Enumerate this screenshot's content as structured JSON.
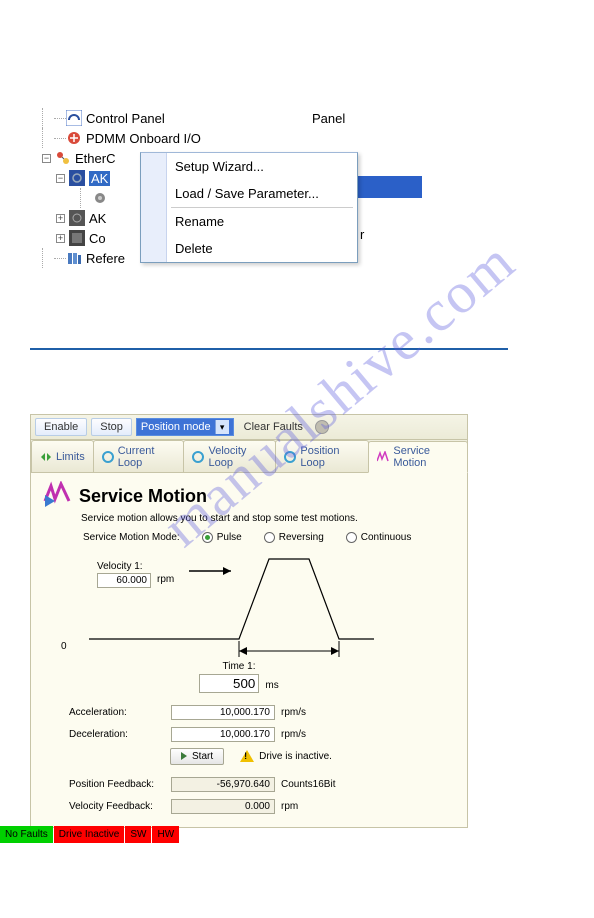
{
  "tree": {
    "control_panel": "Control Panel",
    "panel": "Panel",
    "pdmm": "PDMM Onboard I/O",
    "ether": "EtherC",
    "ak1": "AK",
    "ak2": "AK",
    "co": "Co",
    "co_right": "r",
    "refere": "Refere"
  },
  "context_menu": {
    "setup": "Setup Wizard...",
    "load": "Load / Save Parameter...",
    "rename": "Rename",
    "delete": "Delete"
  },
  "toolbar": {
    "enable": "Enable",
    "stop": "Stop",
    "mode": "Position mode",
    "clear": "Clear Faults"
  },
  "tabs": {
    "limits": "Limits",
    "current": "Current Loop",
    "velocity": "Velocity Loop",
    "position": "Position Loop",
    "service": "Service Motion"
  },
  "service_motion": {
    "title": "Service Motion",
    "subtitle": "Service motion allows you to start and stop some test motions.",
    "mode_label": "Service Motion Mode:",
    "pulse": "Pulse",
    "reversing": "Reversing",
    "continuous": "Continuous",
    "velocity1_label": "Velocity 1:",
    "velocity1_value": "60.000",
    "velocity1_unit": "rpm",
    "zero": "0",
    "time1_label": "Time 1:",
    "time1_value": "500",
    "time1_unit": "ms",
    "accel_label": "Acceleration:",
    "accel_value": "10,000.170",
    "accel_unit": "rpm/s",
    "decel_label": "Deceleration:",
    "decel_value": "10,000.170",
    "decel_unit": "rpm/s",
    "start": "Start",
    "warn": "Drive is inactive.",
    "posfb_label": "Position Feedback:",
    "posfb_value": "-56,970.640",
    "posfb_unit": "Counts16Bit",
    "velfb_label": "Velocity Feedback:",
    "velfb_value": "0.000",
    "velfb_unit": "rpm"
  },
  "status": {
    "no_faults": "No Faults",
    "drive_inactive": "Drive Inactive",
    "sw": "SW",
    "hw": "HW"
  },
  "watermark": "manualshive.com"
}
